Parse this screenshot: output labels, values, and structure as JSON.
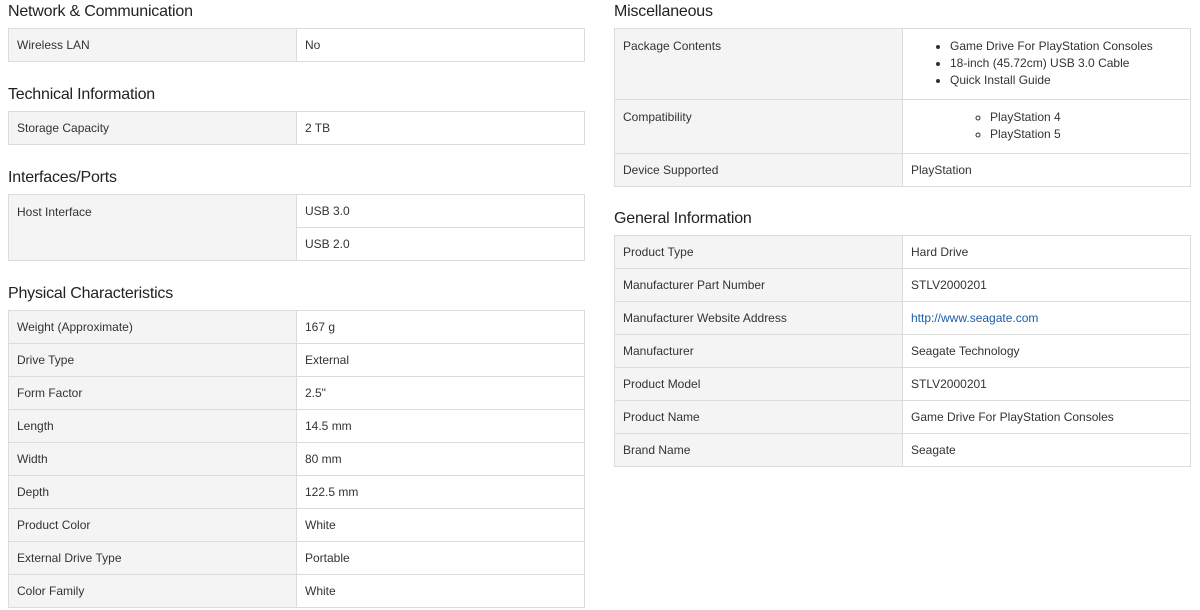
{
  "left": {
    "network": {
      "heading": "Network & Communication",
      "rows": [
        {
          "label": "Wireless LAN",
          "value": "No"
        }
      ]
    },
    "technical": {
      "heading": "Technical Information",
      "rows": [
        {
          "label": "Storage Capacity",
          "value": "2 TB"
        }
      ]
    },
    "interfaces": {
      "heading": "Interfaces/Ports",
      "label": "Host Interface",
      "values": [
        "USB 3.0",
        "USB 2.0"
      ]
    },
    "physical": {
      "heading": "Physical Characteristics",
      "rows": [
        {
          "label": "Weight (Approximate)",
          "value": "167 g"
        },
        {
          "label": "Drive Type",
          "value": "External"
        },
        {
          "label": "Form Factor",
          "value": "2.5\""
        },
        {
          "label": "Length",
          "value": "14.5 mm"
        },
        {
          "label": "Width",
          "value": "80 mm"
        },
        {
          "label": "Depth",
          "value": "122.5 mm"
        },
        {
          "label": "Product Color",
          "value": "White"
        },
        {
          "label": "External Drive Type",
          "value": "Portable"
        },
        {
          "label": "Color Family",
          "value": "White"
        }
      ]
    }
  },
  "right": {
    "misc": {
      "heading": "Miscellaneous",
      "package_label": "Package Contents",
      "package_items": [
        "Game Drive For PlayStation Consoles",
        "18-inch (45.72cm) USB 3.0 Cable",
        "Quick Install Guide"
      ],
      "compat_label": "Compatibility",
      "compat_items": [
        "PlayStation 4",
        "PlayStation 5"
      ],
      "device_label": "Device Supported",
      "device_value": "PlayStation"
    },
    "general": {
      "heading": "General Information",
      "rows": [
        {
          "label": "Product Type",
          "value": "Hard Drive"
        },
        {
          "label": "Manufacturer Part Number",
          "value": "STLV2000201"
        },
        {
          "label": "Manufacturer Website Address",
          "value": "http://www.seagate.com"
        },
        {
          "label": "Manufacturer",
          "value": "Seagate Technology"
        },
        {
          "label": "Product Model",
          "value": "STLV2000201"
        },
        {
          "label": "Product Name",
          "value": "Game Drive For PlayStation Consoles"
        },
        {
          "label": "Brand Name",
          "value": "Seagate"
        }
      ]
    }
  },
  "colors": {
    "link": "#1a5ea8",
    "label_bg": "#f4f4f4",
    "border": "#dcdcdc"
  }
}
